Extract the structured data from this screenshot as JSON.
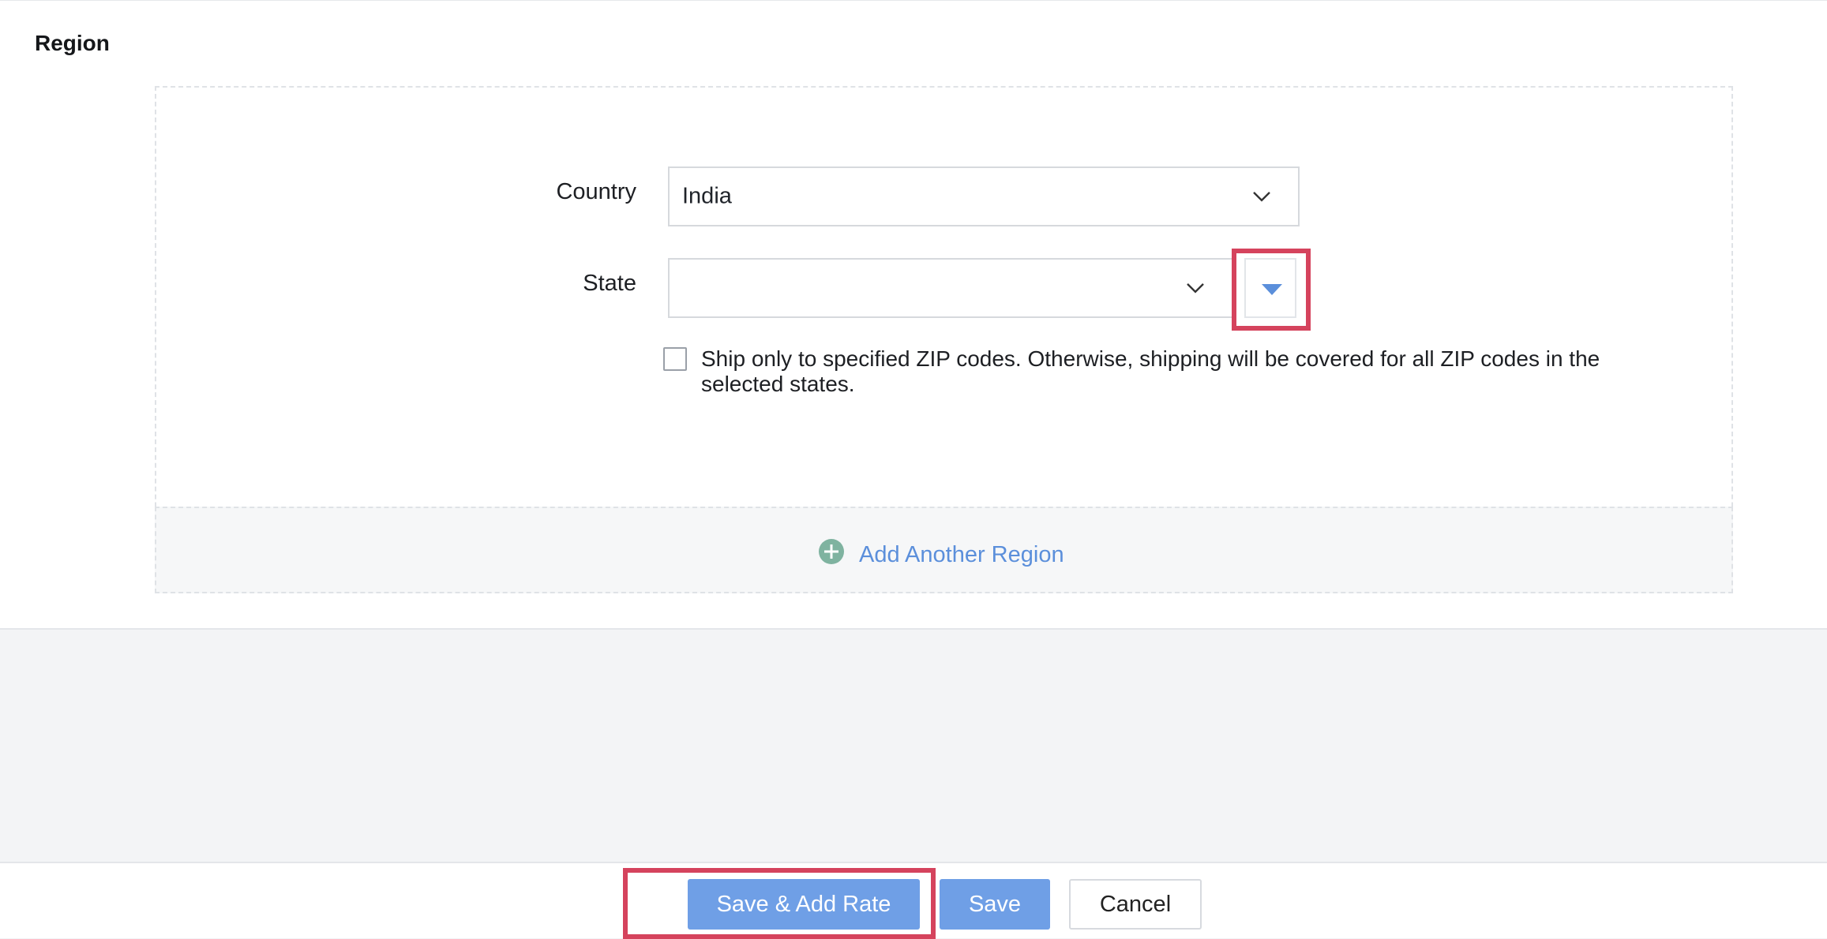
{
  "section": {
    "title": "Region"
  },
  "form": {
    "country_label": "Country",
    "country_value": "India",
    "state_label": "State",
    "state_value": "",
    "zip_checkbox_label": "Ship only to specified ZIP codes. Otherwise, shipping will be covered for all ZIP codes in the selected states.",
    "zip_checked": false
  },
  "region": {
    "add_label": "Add Another Region"
  },
  "footer": {
    "save_add_rate_label": "Save & Add Rate",
    "save_label": "Save",
    "cancel_label": "Cancel"
  },
  "colors": {
    "primary": "#6f9fe6",
    "link": "#5b8fdb",
    "add_icon": "#7fb3a0",
    "highlight": "#d5435d"
  },
  "icons": {
    "select_chevron": "chevron-down-icon",
    "state_toggle": "caret-down-icon",
    "add": "plus-circle-icon"
  }
}
